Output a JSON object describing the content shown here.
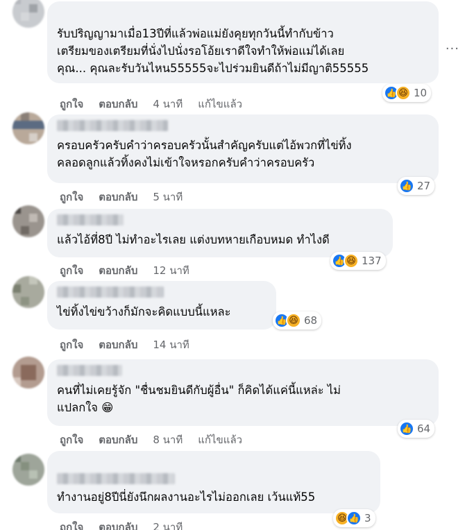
{
  "comments": [
    {
      "lines": [
        "รับปริญญามาเมื่อ13ปีที่แล้วพ่อแม่ยังคุยทุกวันนี้ทำกับข้าว",
        "เตรียมของเตรียมที่นั่งไปนั่งรอโอ้ยเราดีใจทำให้พ่อแม่ได้เลย",
        "คุณ... คุณละรับวันไหน55555จะไปร่วมยินดีถ้าไม่มีญาติ55555"
      ],
      "reaction_count": "10",
      "reactions": [
        "like-icon",
        "haha-icon"
      ],
      "like_label": "ถูกใจ",
      "reply_label": "ตอบกลับ",
      "time": "4 นาที",
      "edited": "แก้ไขแล้ว"
    },
    {
      "lines": [
        "ครอบครัวครับคำว่าครอบครัวนั้นสำคัญครับแต่ไอ้พวกที่ไข่ทิ้ง",
        "คลอดลูกแล้วทิ้งคงไม่เข้าใจหรอกครับคำว่าครอบครัว"
      ],
      "reaction_count": "27",
      "reactions": [
        "like-icon"
      ],
      "like_label": "ถูกใจ",
      "reply_label": "ตอบกลับ",
      "time": "5 นาที"
    },
    {
      "lines": [
        "แล้วไอ้ที่8ปี ไม่ทำอะไรเลย แต่งบทหายเกือบหมด ทำไงดี"
      ],
      "reaction_count": "137",
      "reactions": [
        "like-icon",
        "haha-icon"
      ],
      "like_label": "ถูกใจ",
      "reply_label": "ตอบกลับ",
      "time": "12 นาที"
    },
    {
      "lines": [
        "ไข่ทิ้งไข่ขว้างก็มักจะคิดแบบนี้แหละ"
      ],
      "reaction_count": "68",
      "reactions": [
        "like-icon",
        "haha-icon"
      ],
      "like_label": "ถูกใจ",
      "reply_label": "ตอบกลับ",
      "time": "14 นาที"
    },
    {
      "lines": [
        "คนที่ไม่เคยรู้จัก \"ชื่นชมยินดีกับผู้อื่น\" ก็คิดได้แค่นี้แหล่ะ ไม่",
        "แปลกใจ 😁"
      ],
      "reaction_count": "64",
      "reactions": [
        "like-icon"
      ],
      "like_label": "ถูกใจ",
      "reply_label": "ตอบกลับ",
      "time": "8 นาที",
      "edited": "แก้ไขแล้ว"
    },
    {
      "lines": [
        "ทำงานอยู่8ปีนี่ยังนึกผลงานอะไรไม่ออกเลย เว้นแท้55"
      ],
      "reaction_count": "3",
      "reactions": [
        "haha-icon",
        "like-icon"
      ],
      "like_label": "ถูกใจ",
      "reply_label": "ตอบกลับ",
      "time": "2 นาที"
    }
  ],
  "more_menu": "···"
}
